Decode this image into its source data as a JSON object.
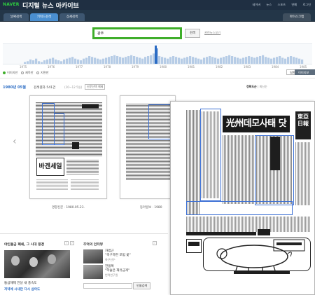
{
  "header": {
    "logo": "NAVER",
    "title": "디지털 뉴스 아카이브",
    "beta": "BETA",
    "links": [
      "네이버",
      "뉴스",
      "스포츠",
      "연예",
      "로그인"
    ]
  },
  "tabs": [
    {
      "label": "날짜검색",
      "active": false
    },
    {
      "label": "키워드검색",
      "active": true
    },
    {
      "label": "상세검색",
      "active": false
    }
  ],
  "my_scrap": "마이스크랩",
  "search": {
    "value": "광주",
    "button": "검색",
    "advanced": "관련뉴스보기"
  },
  "timeline": {
    "years": [
      "1975",
      "1976",
      "1977",
      "1978",
      "1979",
      "1980",
      "1981",
      "1982",
      "1983",
      "1984",
      "1985"
    ],
    "selected_year": "1980",
    "bars": [
      2,
      3,
      5,
      4,
      6,
      3,
      2,
      4,
      5,
      6,
      7,
      5,
      4,
      3,
      5,
      6,
      7,
      8,
      6,
      5,
      4,
      6,
      7,
      9,
      8,
      7,
      6,
      5,
      6,
      7,
      8,
      9,
      10,
      9,
      8,
      7,
      8,
      9,
      10,
      9,
      8,
      7,
      6,
      8,
      9,
      10,
      12,
      18,
      9,
      8,
      7,
      6,
      8,
      9,
      8,
      7,
      6,
      7,
      8,
      9,
      8,
      7,
      6,
      5,
      7,
      8,
      9,
      8,
      7,
      6,
      7,
      8,
      9,
      10,
      9,
      8,
      7,
      6,
      7,
      8,
      9,
      8,
      7,
      8,
      9,
      10,
      8,
      7,
      6,
      7,
      8,
      9,
      7,
      6,
      8,
      9,
      8,
      7,
      6,
      5
    ],
    "selected_index": 47
  },
  "filters": [
    {
      "label": "이미지만",
      "on": true
    },
    {
      "label": "제목만",
      "on": false
    },
    {
      "label": "지면만",
      "on": false
    }
  ],
  "view_modes": [
    "일반",
    "이미지보기"
  ],
  "result": {
    "date": "1980년 05월",
    "count": "검색결과 541건",
    "range": "(10~12 5일)",
    "paper_filter": "신문선택 해제",
    "sort_label": "정확도순",
    "sort_alt": "최신순"
  },
  "thumbs": [
    {
      "caption": "경향신문 · 1980.05.23."
    },
    {
      "caption": "동아일보 · 1980"
    }
  ],
  "preview": {
    "headline": "光州데모사태 닷새째",
    "masthead": "東亞日報"
  },
  "bottom": {
    "story_title": "야인돌금 폐쇄, 그 시대 풍경",
    "story_caption": "통금해제 전날 새 풍속도",
    "story_headline": "저녁에 시내만 다시 삼아도",
    "side_title": "추억의 인터뷰",
    "side_items": [
      {
        "line1": "차범근",
        "line2": "\"축구하면 모범 꽃\"",
        "sub": "축구선수"
      },
      {
        "line1": "전을복",
        "line2": "\"학술은 재유금게\"",
        "sub": "번역연구원"
      }
    ],
    "profile_button": "인물검색"
  },
  "colors": {
    "accent_green": "#3fae2a",
    "header_bg": "#1f2f42",
    "link_blue": "#2b6cc4"
  }
}
